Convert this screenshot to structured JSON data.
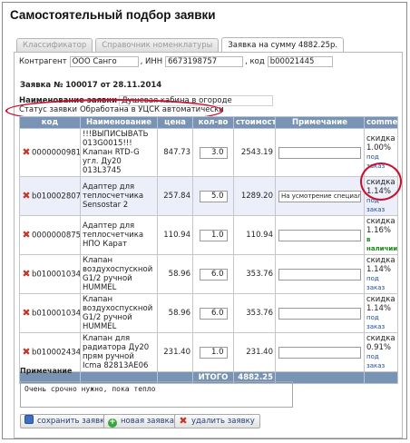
{
  "page_title": "Самостоятельный подбор заявки",
  "tabs": [
    "Классификатор",
    "Справочник номенклатуры",
    "Заявка на сумму 4882.25р."
  ],
  "counterparty": {
    "label": "Контрагент",
    "name": "ООО Санго",
    "inn_label": ", ИНН",
    "inn": "6673198757",
    "code_label": ", код",
    "code": "b00021445"
  },
  "order": {
    "title": "Заявка № 100017 от 28.11.2014",
    "name_label": "Наименование заявки",
    "name_value": "Душевая кабина в огороде",
    "status_label": "Статус заявки",
    "status_value": "Обработана в УЦСК автоматически"
  },
  "table": {
    "headers": [
      "код",
      "Наименование",
      "цена",
      "кол-во",
      "стоимость",
      "Примечание",
      "comment"
    ],
    "rows": [
      {
        "code": "00000009814",
        "name": "!!!ВЫПИСЫВАТЬ 013G0015!!! Клапан RTD-G угл. Ду20 013L3745",
        "price": "847.73",
        "qty": "3.0",
        "cost": "2543.19",
        "note": "",
        "discount": "скидка 1.00%",
        "status": "под заказ",
        "status_type": "order"
      },
      {
        "code": "b0100028077",
        "name": "Адаптер для теплосчетчика Sensostar 2",
        "price": "257.84",
        "qty": "5.0",
        "cost": "1289.20",
        "note": "На усмотрение специалиста",
        "discount": "скидка 1.14%",
        "status": "под заказ",
        "status_type": "order"
      },
      {
        "code": "00000008759",
        "name": "Адаптер для теплосчетчика НПО Карат",
        "price": "110.94",
        "qty": "1.0",
        "cost": "110.94",
        "note": "",
        "discount": "скидка 1.16%",
        "status": "в наличии",
        "status_type": "stock"
      },
      {
        "code": "b0100010347",
        "name": "Клапан воздухоспускной G1/2 ручной HUMMEL",
        "price": "58.96",
        "qty": "6.0",
        "cost": "353.76",
        "note": "",
        "discount": "скидка 1.14%",
        "status": "под заказ",
        "status_type": "order"
      },
      {
        "code": "b0100010347",
        "name": "Клапан воздухоспускной G1/2 ручной HUMMEL",
        "price": "58.96",
        "qty": "6.0",
        "cost": "353.76",
        "note": "",
        "discount": "скидка 1.14%",
        "status": "под заказ",
        "status_type": "order"
      },
      {
        "code": "b0100024346",
        "name": "Клапан для радиатора Ду20 прям ручной Icma 82813AE06",
        "price": "231.40",
        "qty": "1.0",
        "cost": "231.40",
        "note": "",
        "discount": "скидка 0.91%",
        "status": "под заказ",
        "status_type": "order"
      }
    ],
    "total_label": "ИТОГО",
    "total_value": "4882.25"
  },
  "note": {
    "label": "Примечание",
    "value": "Очень срочно нужно, пока тепло"
  },
  "buttons": {
    "save": "сохранить заявку",
    "new": "новая заявка",
    "delete": "удалить заявку"
  },
  "colors": {
    "header_bg": "#7893b3",
    "highlight_circle": "#c8102e",
    "delete_icon": "#c0392b",
    "status_order": "#1d4fa0",
    "status_stock": "#1a8a1a"
  },
  "icons": {
    "row_delete": "delete-x-icon",
    "save": "floppy-disk-icon",
    "new": "plus-circle-icon",
    "delete": "delete-x-icon"
  }
}
